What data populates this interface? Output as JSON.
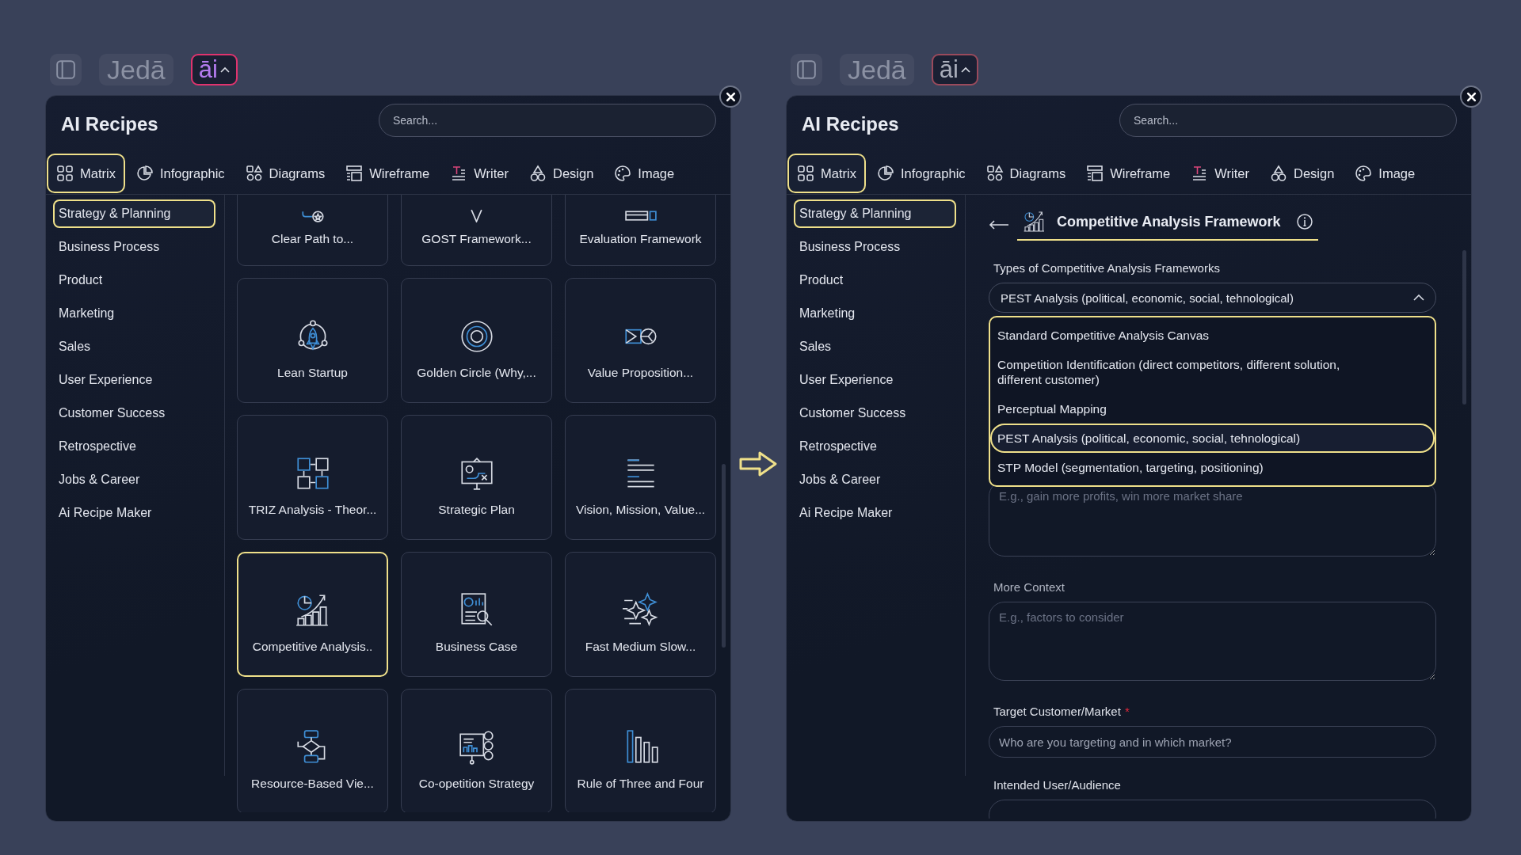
{
  "panels": [
    {
      "kind": "grid",
      "toolbar": {
        "logo": "Jedā",
        "ai_label": "āi",
        "active": true
      },
      "title": "AI Recipes",
      "search": {
        "placeholder": "Search..."
      },
      "tabs": [
        {
          "label": "Matrix",
          "selected": true
        },
        {
          "label": "Infographic",
          "selected": false
        },
        {
          "label": "Diagrams",
          "selected": false
        },
        {
          "label": "Wireframe",
          "selected": false
        },
        {
          "label": "Writer",
          "selected": false
        },
        {
          "label": "Design",
          "selected": false
        },
        {
          "label": "Image",
          "selected": false
        }
      ],
      "categories": [
        {
          "label": "Strategy & Planning",
          "selected": true
        },
        {
          "label": "Business Process",
          "selected": false
        },
        {
          "label": "Product",
          "selected": false
        },
        {
          "label": "Marketing",
          "selected": false
        },
        {
          "label": "Sales",
          "selected": false
        },
        {
          "label": "User Experience",
          "selected": false
        },
        {
          "label": "Customer Success",
          "selected": false
        },
        {
          "label": "Retrospective",
          "selected": false
        },
        {
          "label": "Jobs & Career",
          "selected": false
        },
        {
          "label": "Ai Recipe Maker",
          "selected": false
        }
      ],
      "cards": [
        {
          "label": "Clear Path to...",
          "selected": false
        },
        {
          "label": "GOST Framework...",
          "selected": false
        },
        {
          "label": "Evaluation Framework",
          "selected": false
        },
        {
          "label": "Lean Startup",
          "selected": false
        },
        {
          "label": "Golden Circle (Why,...",
          "selected": false
        },
        {
          "label": "Value Proposition...",
          "selected": false
        },
        {
          "label": "TRIZ Analysis - Theor...",
          "selected": false
        },
        {
          "label": "Strategic Plan",
          "selected": false
        },
        {
          "label": "Vision, Mission, Value...",
          "selected": false
        },
        {
          "label": "Competitive Analysis..",
          "selected": true
        },
        {
          "label": "Business Case",
          "selected": false
        },
        {
          "label": "Fast Medium Slow...",
          "selected": false
        },
        {
          "label": "Resource-Based Vie...",
          "selected": false
        },
        {
          "label": "Co-opetition Strategy",
          "selected": false
        },
        {
          "label": "Rule of Three and Four",
          "selected": false
        }
      ]
    },
    {
      "kind": "form",
      "toolbar": {
        "logo": "Jedā",
        "ai_label": "āi",
        "active": false
      },
      "title": "AI Recipes",
      "search": {
        "placeholder": "Search..."
      },
      "tabs": [
        {
          "label": "Matrix",
          "selected": true
        },
        {
          "label": "Infographic",
          "selected": false
        },
        {
          "label": "Diagrams",
          "selected": false
        },
        {
          "label": "Wireframe",
          "selected": false
        },
        {
          "label": "Writer",
          "selected": false
        },
        {
          "label": "Design",
          "selected": false
        },
        {
          "label": "Image",
          "selected": false
        }
      ],
      "categories": [
        {
          "label": "Strategy & Planning",
          "selected": true
        },
        {
          "label": "Business Process",
          "selected": false
        },
        {
          "label": "Product",
          "selected": false
        },
        {
          "label": "Marketing",
          "selected": false
        },
        {
          "label": "Sales",
          "selected": false
        },
        {
          "label": "User Experience",
          "selected": false
        },
        {
          "label": "Customer Success",
          "selected": false
        },
        {
          "label": "Retrospective",
          "selected": false
        },
        {
          "label": "Jobs & Career",
          "selected": false
        },
        {
          "label": "Ai Recipe Maker",
          "selected": false
        }
      ],
      "form": {
        "title": "Competitive Analysis Framework",
        "fields": [
          {
            "kind": "select",
            "label": "Types of Competitive Analysis Frameworks",
            "value": "PEST Analysis (political, economic, social, tehnological)",
            "expanded": true,
            "options": [
              {
                "label": "Standard Competitive Analysis Canvas",
                "selected": false
              },
              {
                "label": "Competition Identification (direct competitors, different solution, different customer)",
                "selected": false
              },
              {
                "label": "Perceptual Mapping",
                "selected": false
              },
              {
                "label": "PEST Analysis (political, economic, social, tehnological)",
                "selected": true
              },
              {
                "label": "STP Model (segmentation, targeting, positioning)",
                "selected": false
              }
            ]
          },
          {
            "kind": "textarea",
            "placeholder": "E.g., gain more profits, win more market share"
          },
          {
            "kind": "textarea",
            "label": "More Context",
            "placeholder": "E.g., factors to consider"
          },
          {
            "kind": "input",
            "label": "Target Customer/Market",
            "required_mark": "*",
            "placeholder": "Who are you targeting and in which market?"
          },
          {
            "kind": "input",
            "label": "Intended User/Audience"
          }
        ]
      }
    }
  ]
}
